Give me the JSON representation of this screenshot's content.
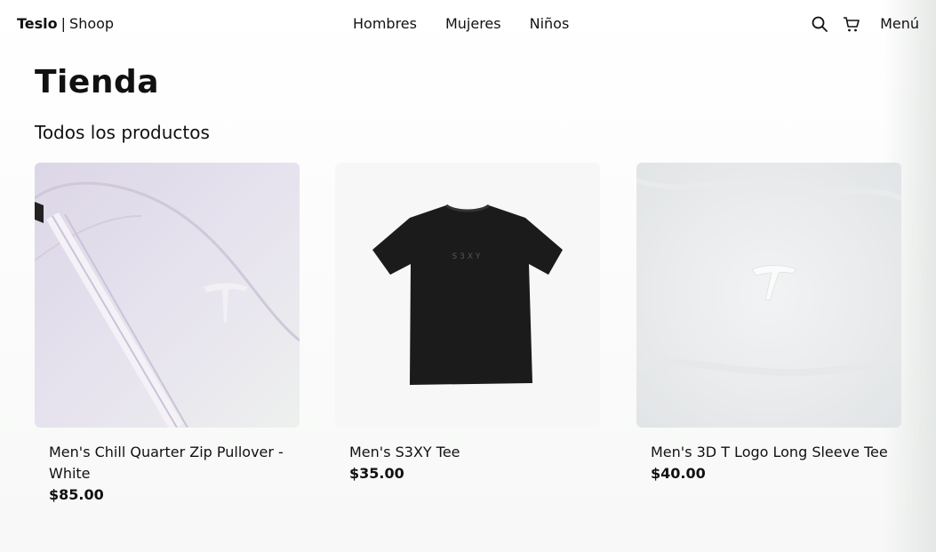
{
  "header": {
    "brand_bold": "Teslo",
    "brand_sep": "|",
    "brand_rest": "Shoop",
    "nav": [
      "Hombres",
      "Mujeres",
      "Niños"
    ],
    "menu_label": "Menú",
    "icons": [
      "search-icon",
      "cart-icon"
    ]
  },
  "main": {
    "title": "Tienda",
    "subtitle": "Todos los productos"
  },
  "products": [
    {
      "name": "Men's Chill Quarter Zip Pullover - White",
      "price": "$85.00",
      "image": "white quarter zip pullover close-up"
    },
    {
      "name": "Men's S3XY Tee",
      "price": "$35.00",
      "image": "black t-shirt with S3XY print"
    },
    {
      "name": "Men's 3D T Logo Long Sleeve Tee",
      "price": "$40.00",
      "image": "white fabric with 3D T logo"
    }
  ],
  "colors": {
    "text": "#111111",
    "background": "#ffffff"
  }
}
